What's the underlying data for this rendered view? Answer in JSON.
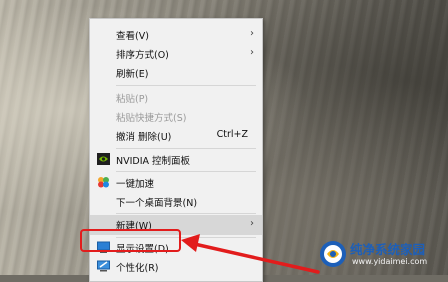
{
  "context_menu": {
    "items": [
      {
        "label": "查看(V)",
        "has_submenu": true
      },
      {
        "label": "排序方式(O)",
        "has_submenu": true
      },
      {
        "label": "刷新(E)"
      },
      {
        "label": "粘贴(P)",
        "disabled": true
      },
      {
        "label": "粘贴快捷方式(S)",
        "disabled": true
      },
      {
        "label": "撤消 删除(U)",
        "shortcut": "Ctrl+Z"
      },
      {
        "label": "NVIDIA 控制面板",
        "icon": "nvidia-icon"
      },
      {
        "label": "一键加速",
        "icon": "accelerate-icon"
      },
      {
        "label": "下一个桌面背景(N)"
      },
      {
        "label": "新建(W)",
        "has_submenu": true,
        "highlighted": true
      },
      {
        "label": "显示设置(D)",
        "icon": "display-icon"
      },
      {
        "label": "个性化(R)",
        "icon": "personalize-icon"
      }
    ]
  },
  "annotation": {
    "highlight_color": "#e21c1c"
  },
  "watermark": {
    "title": "纯净系统家园",
    "url": "www.yidaimei.com"
  }
}
